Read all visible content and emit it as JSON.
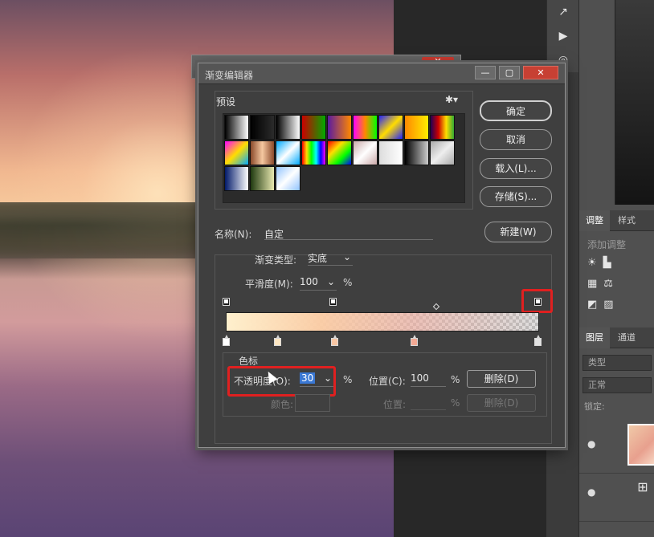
{
  "dialog": {
    "title": "渐变编辑器",
    "win_buttons": [
      "—",
      "▢",
      "✕"
    ],
    "presets_label": "预设",
    "buttons": {
      "ok": "确定",
      "cancel": "取消",
      "load": "载入(L)...",
      "save": "存储(S)...",
      "new": "新建(W)"
    },
    "name_label": "名称(N):",
    "name_value": "自定",
    "gradient_type_label": "渐变类型:",
    "gradient_type_value": "实底",
    "smoothness_label": "平滑度(M):",
    "smoothness_value": "100",
    "smoothness_unit": "%",
    "stops_label": "色标",
    "opacity_label": "不透明度(O):",
    "opacity_value": "30",
    "opacity_unit": "%",
    "location_label": "位置(C):",
    "location_value": "100",
    "location_unit": "%",
    "delete_label": "删除(D)",
    "color_label": "颜色:",
    "color_location_label": "位置:",
    "color_location_unit": "%",
    "color_delete_label": "删除(D)",
    "swatch_colors": [
      "linear-gradient(90deg,#000,#fff)",
      "linear-gradient(90deg,#000,transparent)",
      "linear-gradient(90deg,#000,#fff)",
      "linear-gradient(90deg,#c00,#0a0)",
      "linear-gradient(90deg,#5a1aa0,#f80)",
      "linear-gradient(90deg,#f0f,#f80,#0f0)",
      "linear-gradient(135deg,#22f,#fd0,#22f)",
      "linear-gradient(90deg,#f80,#fe0)",
      "linear-gradient(90deg,#205,#c00,#fd0,#3a3)",
      "linear-gradient(135deg,#f0f,#fd0,#0af)",
      "linear-gradient(90deg,#8b4a2b,#f5c8a0,#8b4a2b)",
      "linear-gradient(135deg,#0af,#fff,#0af)",
      "linear-gradient(90deg,#f00,#fd0,#0f0,#0ff,#00f,#f0f)",
      "linear-gradient(135deg,#f00,#fd0,#0f0,#00f)",
      "linear-gradient(135deg,#caa,#fff,#caa)",
      "linear-gradient(90deg,#ddd,#fff)",
      "linear-gradient(90deg,#000,#ccc)",
      "linear-gradient(135deg,#aaa,#eee,#aaa)",
      "linear-gradient(90deg,#021a6a,#fff)",
      "linear-gradient(90deg,#203a10,#e8e8b0)",
      "linear-gradient(135deg,#8fc3ff,#fff,#8fc3ff)"
    ],
    "bottom_stop_colors": [
      "#ffffff",
      "#fde6c2",
      "#f8c6a4",
      "#f3a994",
      "#e2e2e2"
    ],
    "top_stop_colors": [
      "#ffffff",
      "#ffffff",
      "#ffffff"
    ]
  },
  "right_panel": {
    "tabs_top": [
      "调整",
      "样式"
    ],
    "add_adjustment_label": "添加调整",
    "tabs_layers": [
      "图层",
      "通道"
    ],
    "layer_search_placeholder": "类型",
    "blend_mode": "正常",
    "lock_label": "锁定:"
  },
  "toolbar_icons": [
    "↗",
    "▶",
    "◎"
  ]
}
